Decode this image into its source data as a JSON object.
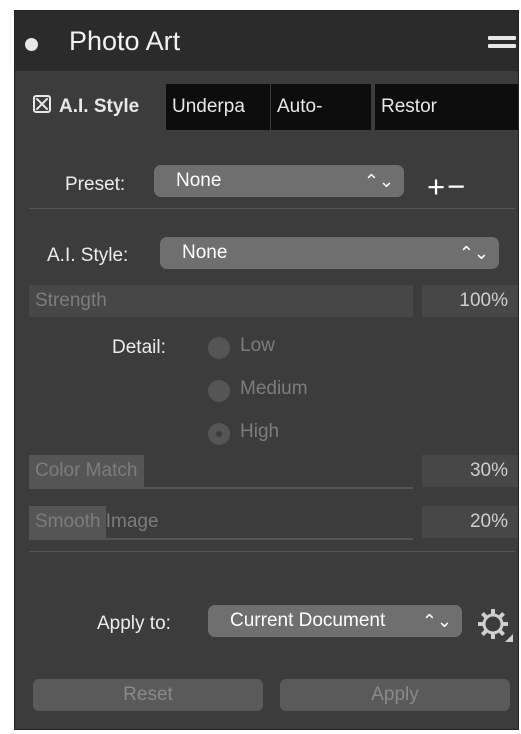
{
  "panel": {
    "title": "Photo Art"
  },
  "tabs": [
    {
      "label": "A.I. Style",
      "active": true
    },
    {
      "label": "Underpa",
      "active": false
    },
    {
      "label": "Auto-",
      "active": false
    },
    {
      "label": "Restor",
      "active": false
    }
  ],
  "preset": {
    "label": "Preset:",
    "value": "None",
    "add_remove": "+−"
  },
  "ai_style": {
    "label": "A.I. Style:",
    "value": "None"
  },
  "strength": {
    "label": "Strength",
    "value": "100%",
    "fraction": 0.0
  },
  "detail": {
    "label": "Detail:",
    "options": [
      "Low",
      "Medium",
      "High"
    ],
    "selected": "High"
  },
  "color_match": {
    "label": "Color Match",
    "value": "30%",
    "fraction": 0.3
  },
  "smooth_image": {
    "label": "Smooth Image",
    "value": "20%",
    "fraction": 0.2
  },
  "apply_to": {
    "label": "Apply to:",
    "value": "Current Document"
  },
  "buttons": {
    "reset": "Reset",
    "apply": "Apply"
  },
  "colors": {
    "panel_bg": "#3c3c3c",
    "titlebar_bg": "#2b2b2b",
    "select_bg": "#6f6f6f",
    "disabled_text": "#7d7d7d"
  }
}
